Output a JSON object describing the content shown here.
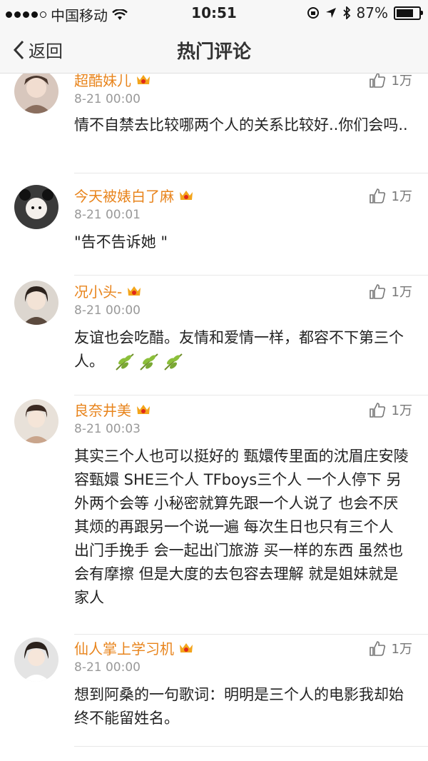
{
  "status": {
    "carrier": "中国移动",
    "time": "10:51",
    "battery": "87%",
    "battery_level": 0.87
  },
  "nav": {
    "back_label": "返回",
    "title": "热门评论"
  },
  "comments": [
    {
      "name": "超酷妹儿",
      "date": "8-21 00:00",
      "likes": "1万",
      "text": "情不自禁去比较哪两个人的关系比较好..你们会吗.."
    },
    {
      "name": "今天被婊白了麻",
      "date": "8-21 00:01",
      "likes": "1万",
      "text": "\"告不告诉她 \""
    },
    {
      "name": "况小头-",
      "date": "8-21 00:00",
      "likes": "1万",
      "text": "友谊也会吃醋。友情和爱情一样，都容不下第三个人。"
    },
    {
      "name": "良奈井美",
      "date": "8-21 00:03",
      "likes": "1万",
      "text": "其实三个人也可以挺好的 甄嬛传里面的沈眉庄安陵容甄嬛 SHE三个人 TFboys三个人 一个人停下 另外两个会等 小秘密就算先跟一个人说了 也会不厌其烦的再跟另一个说一遍 每次生日也只有三个人 出门手挽手 会一起出门旅游 买一样的东西 虽然也会有摩擦 但是大度的去包容去理解 就是姐妹就是家人"
    },
    {
      "name": "仙人掌上学习机",
      "date": "8-21 00:00",
      "likes": "1万",
      "text": "想到阿桑的一句歌词：明明是三个人的电影我却始终不能留姓名。"
    }
  ]
}
